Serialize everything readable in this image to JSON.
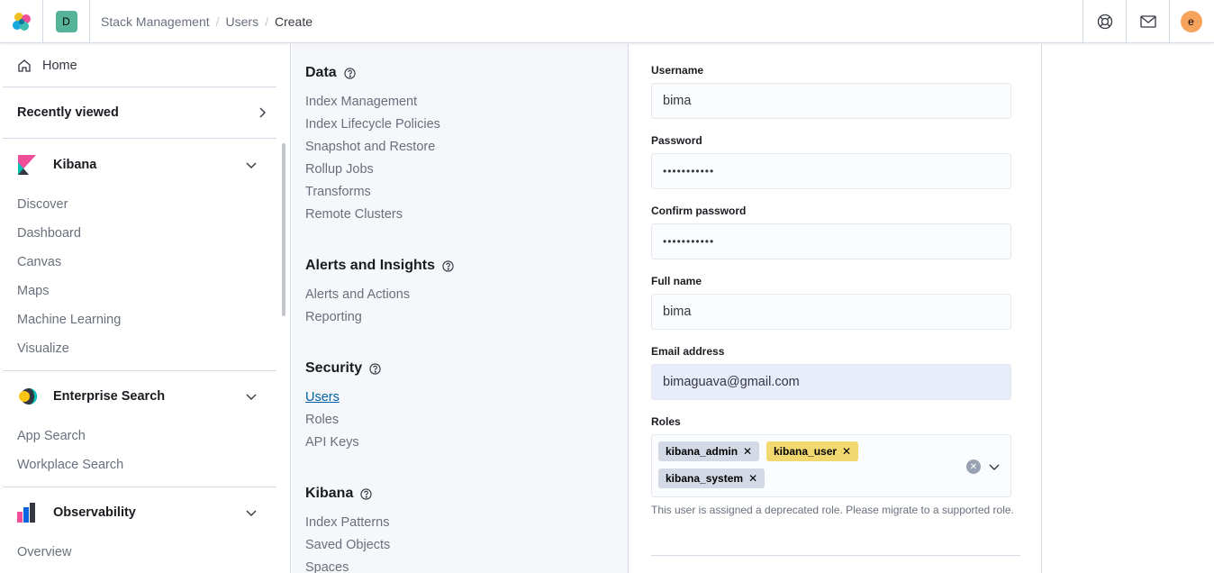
{
  "header": {
    "logo": "elastic-logo",
    "space_initial": "D",
    "breadcrumbs": [
      "Stack Management",
      "Users",
      "Create"
    ],
    "user_initial": "e",
    "help_icon": "help-lifebuoy-icon",
    "mail_icon": "mail-icon"
  },
  "sidenav": {
    "home": "Home",
    "recently_viewed": "Recently viewed",
    "groups": [
      {
        "title": "Kibana",
        "icon": "kibana-logo",
        "items": [
          "Discover",
          "Dashboard",
          "Canvas",
          "Maps",
          "Machine Learning",
          "Visualize"
        ]
      },
      {
        "title": "Enterprise Search",
        "icon": "enterprise-search-logo",
        "items": [
          "App Search",
          "Workplace Search"
        ]
      },
      {
        "title": "Observability",
        "icon": "observability-logo",
        "items": [
          "Overview"
        ]
      }
    ]
  },
  "management": {
    "sections": [
      {
        "title": "Data",
        "items": [
          "Index Management",
          "Index Lifecycle Policies",
          "Snapshot and Restore",
          "Rollup Jobs",
          "Transforms",
          "Remote Clusters"
        ]
      },
      {
        "title": "Alerts and Insights",
        "items": [
          "Alerts and Actions",
          "Reporting"
        ]
      },
      {
        "title": "Security",
        "items": [
          "Users",
          "Roles",
          "API Keys"
        ],
        "active": "Users"
      },
      {
        "title": "Kibana",
        "items": [
          "Index Patterns",
          "Saved Objects",
          "Spaces"
        ]
      }
    ]
  },
  "form": {
    "username_label": "Username",
    "username_value": "bima",
    "password_label": "Password",
    "password_value": "•••••••••••",
    "confirm_label": "Confirm password",
    "confirm_value": "•••••••••••",
    "fullname_label": "Full name",
    "fullname_value": "bima",
    "email_label": "Email address",
    "email_value": "bimaguava@gmail.com",
    "roles_label": "Roles",
    "roles": [
      {
        "name": "kibana_admin",
        "color": "#d3dae6"
      },
      {
        "name": "kibana_user",
        "color": "#f1d86f"
      },
      {
        "name": "kibana_system",
        "color": "#d3dae6"
      }
    ],
    "roles_help": "This user is assigned a deprecated role. Please migrate to a supported role."
  }
}
